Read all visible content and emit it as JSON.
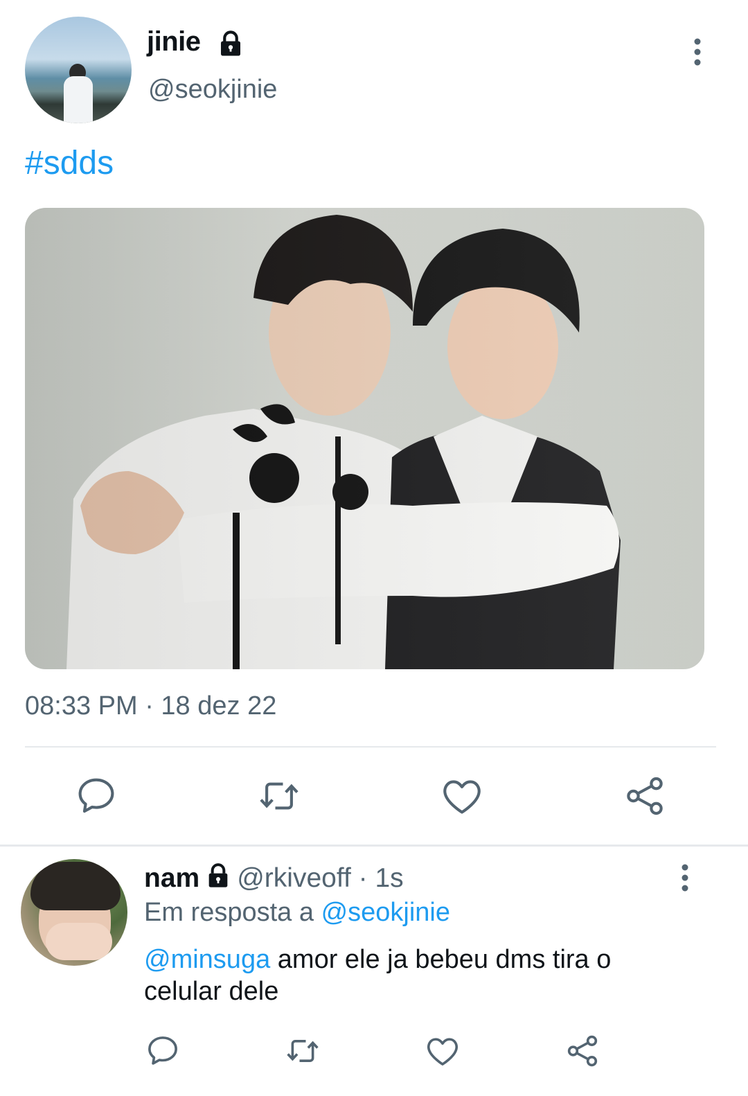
{
  "tweet": {
    "display_name": "jinie",
    "handle": "@seokjinie",
    "text": "#sdds",
    "timestamp": "08:33 PM · 18 dez 22",
    "icons": {
      "lock": "lock-icon",
      "more": "more-vertical-icon",
      "reply": "reply-bubble-icon",
      "retweet": "retweet-icon",
      "like": "heart-icon",
      "share": "share-icon"
    }
  },
  "reply": {
    "display_name": "nam",
    "handle": "@rkiveoff",
    "separator": "·",
    "time": "1s",
    "in_reply_to_prefix": "Em resposta a",
    "in_reply_to_handle": "@seokjinie",
    "mention": "@minsuga",
    "text": "amor ele ja bebeu dms tira o celular dele"
  },
  "colors": {
    "link": "#1d9bf0",
    "secondary_text": "#536471",
    "primary_text": "#0f1419",
    "divider": "#e6e9ec"
  }
}
